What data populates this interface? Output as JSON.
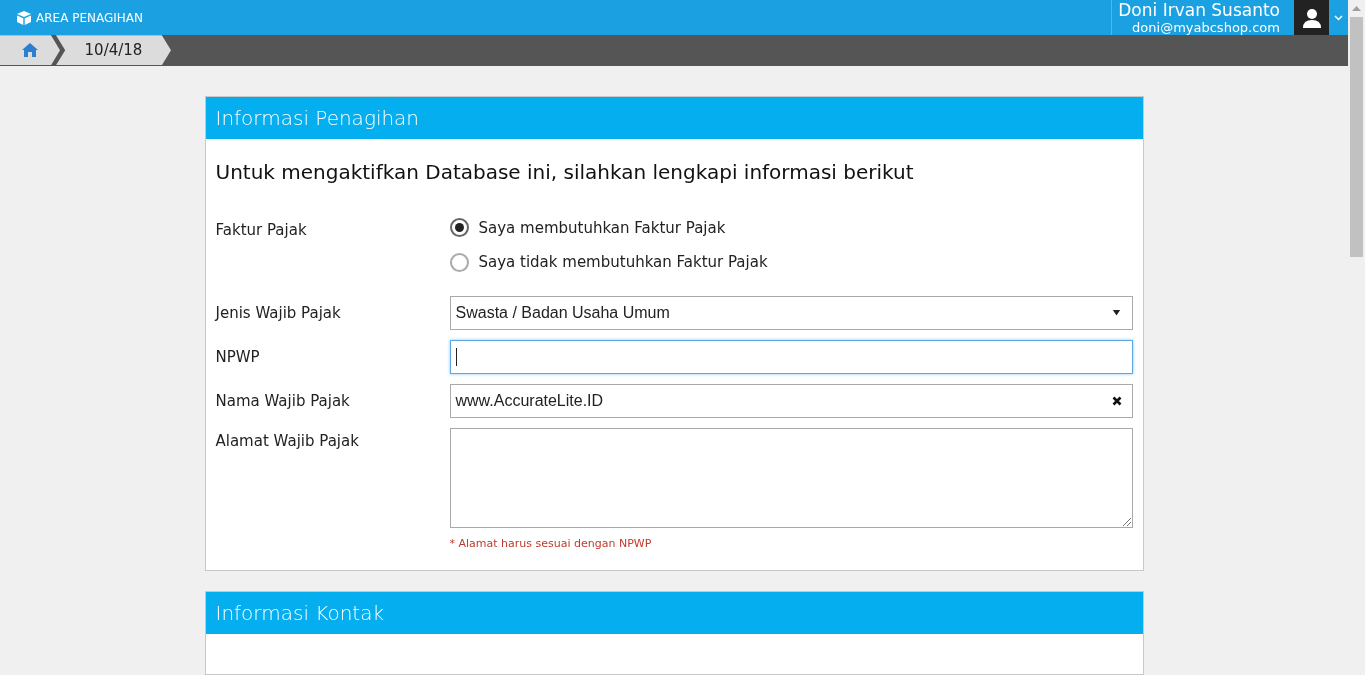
{
  "header": {
    "title": "AREA PENAGIHAN",
    "user_name": "Doni Irvan Susanto",
    "user_email": "doni@myabcshop.com"
  },
  "breadcrumb": [
    {
      "kind": "home"
    },
    {
      "kind": "text",
      "label": "10/4/18"
    }
  ],
  "sections": [
    {
      "title": "Informasi Penagihan",
      "intro": "Untuk mengaktifkan Database ini, silahkan lengkapi informasi berikut",
      "fields": [
        {
          "kind": "radio",
          "label": "Faktur Pajak",
          "options": [
            {
              "label": "Saya membutuhkan Faktur Pajak",
              "selected": true
            },
            {
              "label": "Saya tidak membutuhkan Faktur Pajak",
              "selected": false
            }
          ]
        },
        {
          "kind": "select",
          "label": "Jenis Wajib Pajak",
          "value": "Swasta / Badan Usaha Umum"
        },
        {
          "kind": "text",
          "label": "NPWP",
          "focused": true
        },
        {
          "kind": "text",
          "label": "Nama Wajib Pajak",
          "value": "www.AccurateLite.ID",
          "clearable": true,
          "focused": false
        },
        {
          "kind": "textarea",
          "label": "Alamat Wajib Pajak",
          "hint": "* Alamat harus sesuai dengan NPWP"
        }
      ]
    },
    {
      "title": "Informasi Kontak"
    }
  ]
}
